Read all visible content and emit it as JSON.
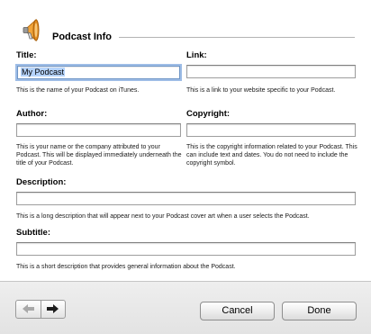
{
  "dialog": {
    "title": "Podcast Info"
  },
  "fields": {
    "title": {
      "label": "Title:",
      "value": "My Podcast",
      "help": "This is the name of your Podcast on iTunes."
    },
    "link": {
      "label": "Link:",
      "value": "",
      "help": "This is a link to your website specific to your Podcast."
    },
    "author": {
      "label": "Author:",
      "value": "",
      "help": "This is your name or the company attributed to your Podcast.  This will be displayed immediately underneath the title of your Podcast."
    },
    "copyright": {
      "label": "Copyright:",
      "value": "",
      "help": "This is the copyright information related to your Podcast.  This can include text and dates.  You do not need to include the copyright symbol."
    },
    "description": {
      "label": "Description:",
      "value": "",
      "help": "This is a long description that will appear next to your Podcast cover art when a user selects the Podcast."
    },
    "subtitle": {
      "label": "Subtitle:",
      "value": "",
      "help": "This is a short description that provides general information about the Podcast."
    }
  },
  "footer": {
    "back_icon": "left-arrow-icon",
    "forward_icon": "right-arrow-icon",
    "cancel_label": "Cancel",
    "done_label": "Done"
  },
  "icons": {
    "app": "megaphone-icon"
  },
  "colors": {
    "focus_ring": "#9ebde6",
    "selection": "#b5d3fb",
    "icon_orange": "#f0a030"
  }
}
